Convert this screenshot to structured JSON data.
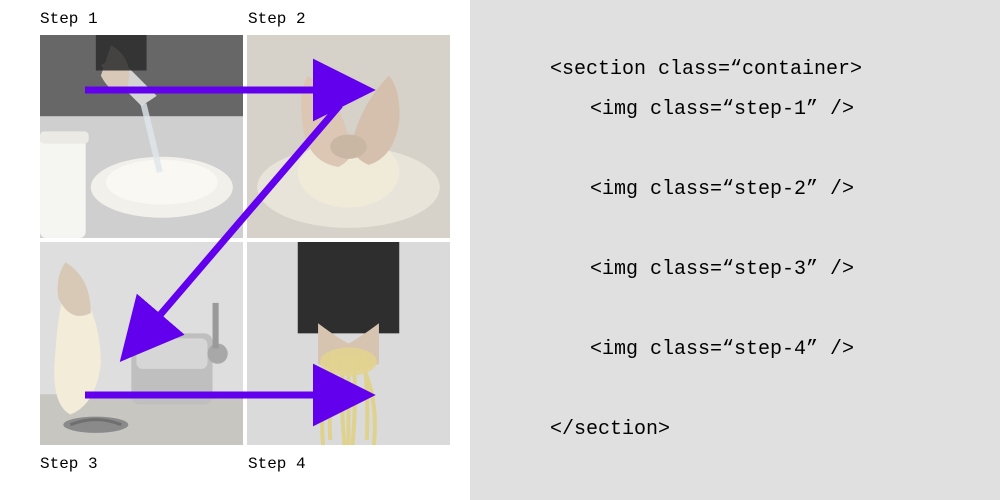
{
  "steps": {
    "s1": "Step 1",
    "s2": "Step 2",
    "s3": "Step 3",
    "s4": "Step 4"
  },
  "arrow_color": "#6200EE",
  "code": {
    "l1": "<section class=“container>",
    "l2": "<img class=“step-1” />",
    "l3": "<img class=“step-2” />",
    "l4": "<img class=“step-3” />",
    "l5": "<img class=“step-4” />",
    "l6": "</section>"
  }
}
